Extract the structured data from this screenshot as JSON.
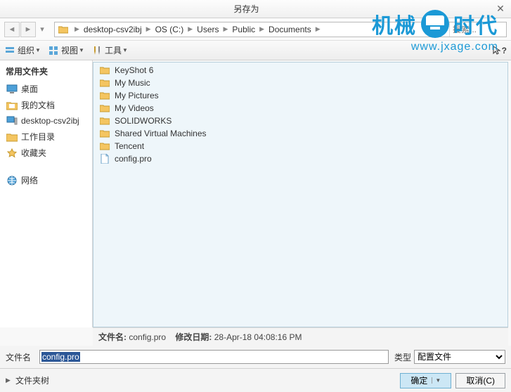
{
  "title": "另存为",
  "breadcrumb": [
    "desktop-csv2ibj",
    "OS (C:)",
    "Users",
    "Public",
    "Documents"
  ],
  "search": {
    "placeholder": "搜索..."
  },
  "toolbar": {
    "organize": "组织",
    "view": "视图",
    "tools": "工具"
  },
  "sidebar": {
    "header": "常用文件夹",
    "items": [
      {
        "label": "桌面",
        "icon": "monitor"
      },
      {
        "label": "我的文档",
        "icon": "folder-doc"
      },
      {
        "label": "desktop-csv2ibj",
        "icon": "computer"
      },
      {
        "label": "工作目录",
        "icon": "folder"
      },
      {
        "label": "收藏夹",
        "icon": "star"
      }
    ],
    "network": "网络"
  },
  "files": [
    {
      "name": "KeyShot 6",
      "icon": "folder"
    },
    {
      "name": "My Music",
      "icon": "folder"
    },
    {
      "name": "My Pictures",
      "icon": "folder"
    },
    {
      "name": "My Videos",
      "icon": "folder"
    },
    {
      "name": "SOLIDWORKS",
      "icon": "folder"
    },
    {
      "name": "Shared Virtual Machines",
      "icon": "folder"
    },
    {
      "name": "Tencent",
      "icon": "folder"
    },
    {
      "name": "config.pro",
      "icon": "file"
    }
  ],
  "status": {
    "fname_label": "文件名:",
    "fname": "config.pro",
    "mdate_label": "修改日期:",
    "mdate": "28-Apr-18 04:08:16 PM"
  },
  "namerow": {
    "label": "文件名",
    "value": "config.pro",
    "type_label": "类型",
    "type_value": "配置文件"
  },
  "footer": {
    "tree": "文件夹树",
    "ok": "确定",
    "cancel": "取消(C)"
  },
  "watermark": {
    "l1": "机械",
    "l2": "时代",
    "url": "www.jxage.com"
  }
}
